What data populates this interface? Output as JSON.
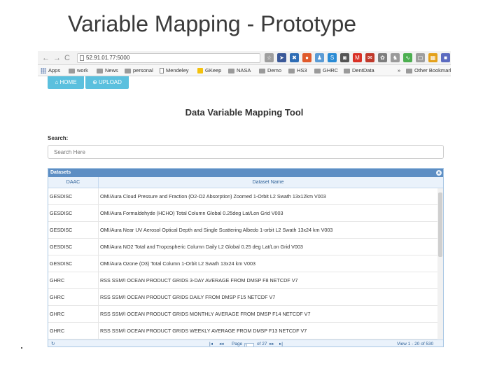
{
  "slide": {
    "title": "Variable Mapping - Prototype"
  },
  "browser": {
    "nav": {
      "back": "←",
      "forward": "→",
      "reload": "C"
    },
    "url": "52.91.01.77:5000",
    "extensions": [
      {
        "icon": "bookmark-star-icon",
        "glyph": "☆",
        "color": "#9e9e9e"
      },
      {
        "icon": "extension-arrow-icon",
        "glyph": "➤",
        "color": "#3b5998"
      },
      {
        "icon": "extension-x-icon",
        "glyph": "✖",
        "color": "#2f6db5"
      },
      {
        "icon": "extension-pin-icon",
        "glyph": "●",
        "color": "#e05a2b"
      },
      {
        "icon": "extension-people-icon",
        "glyph": "♟",
        "color": "#5a9bd5"
      },
      {
        "icon": "extension-s-icon",
        "glyph": "S",
        "color": "#2a8bd4"
      },
      {
        "icon": "camera-icon",
        "glyph": "◙",
        "color": "#555555"
      },
      {
        "icon": "gmail-icon",
        "glyph": "M",
        "color": "#d93025"
      },
      {
        "icon": "notifications-icon",
        "glyph": "✉",
        "color": "#c0392b"
      },
      {
        "icon": "settings-flower-icon",
        "glyph": "✿",
        "color": "#7d7d7d"
      },
      {
        "icon": "people-icon",
        "glyph": "♞",
        "color": "#9a9a9a"
      },
      {
        "icon": "chart-icon",
        "glyph": "∿",
        "color": "#4caf50"
      },
      {
        "icon": "page-icon",
        "glyph": "▢",
        "color": "#9e9e9e"
      },
      {
        "icon": "grid-icon",
        "glyph": "▦",
        "color": "#e4a11b"
      },
      {
        "icon": "square-extension-icon",
        "glyph": "■",
        "color": "#5c6bc0"
      },
      {
        "icon": "menu-icon",
        "glyph": "▯",
        "color": "#8d8d8d"
      }
    ],
    "bookmarks": {
      "apps": "Apps",
      "work": "work",
      "news": "News",
      "personal": "personal",
      "mendeley": "Mendeley",
      "gkeep": "GKeep",
      "nasa": "NASA",
      "demo": "Demo",
      "hs3": "HS3",
      "ghrc": "GHRC",
      "dentdata": "DentData",
      "more": "»",
      "other": "Other Bookmarks"
    }
  },
  "app": {
    "buttons": {
      "home": "HOME",
      "upload": "UPLOAD"
    },
    "title": "Data Variable Mapping Tool",
    "search": {
      "label": "Search:",
      "placeholder": "Search Here"
    },
    "grid": {
      "caption": "Datasets",
      "columns": {
        "daac": "DAAC",
        "name": "Dataset Name"
      },
      "rows": [
        {
          "daac": "GESDISC",
          "name": "OMI/Aura Cloud Pressure and Fraction (O2-O2 Absorption) Zoomed 1-Orbit L2 Swath 13x12km V003"
        },
        {
          "daac": "GESDISC",
          "name": "OMI/Aura Formaldehyde (HCHO) Total Column Global 0.25deg Lat/Lon Grid V003"
        },
        {
          "daac": "GESDISC",
          "name": "OMI/Aura Near UV Aerosol Optical Depth and Single Scattering Albedo 1-orbit L2 Swath 13x24 km V003"
        },
        {
          "daac": "GESDISC",
          "name": "OMI/Aura NO2 Total and Tropospheric Column Daily L2 Global 0.25 deg Lat/Lon Grid V003"
        },
        {
          "daac": "GESDISC",
          "name": "OMI/Aura Ozone (O3) Total Column 1-Orbit L2 Swath 13x24 km V003"
        },
        {
          "daac": "GHRC",
          "name": "RSS SSM/I OCEAN PRODUCT GRIDS 3-DAY AVERAGE FROM DMSP F8 NETCDF V7"
        },
        {
          "daac": "GHRC",
          "name": "RSS SSM/I OCEAN PRODUCT GRIDS DAILY FROM DMSP F15 NETCDF V7"
        },
        {
          "daac": "GHRC",
          "name": "RSS SSM/I OCEAN PRODUCT GRIDS MONTHLY AVERAGE FROM DMSP F14 NETCDF V7"
        },
        {
          "daac": "GHRC",
          "name": "RSS SSM/I OCEAN PRODUCT GRIDS WEEKLY AVERAGE FROM DMSP F13 NETCDF V7"
        }
      ],
      "pager": {
        "refresh": "↻",
        "first": "|◂",
        "prev": "◂◂",
        "page_label": "Page",
        "page_value": "1",
        "of_total": "of 27",
        "next": "▸▸",
        "last": "▸|",
        "view": "View 1 - 20 of 530"
      }
    }
  }
}
